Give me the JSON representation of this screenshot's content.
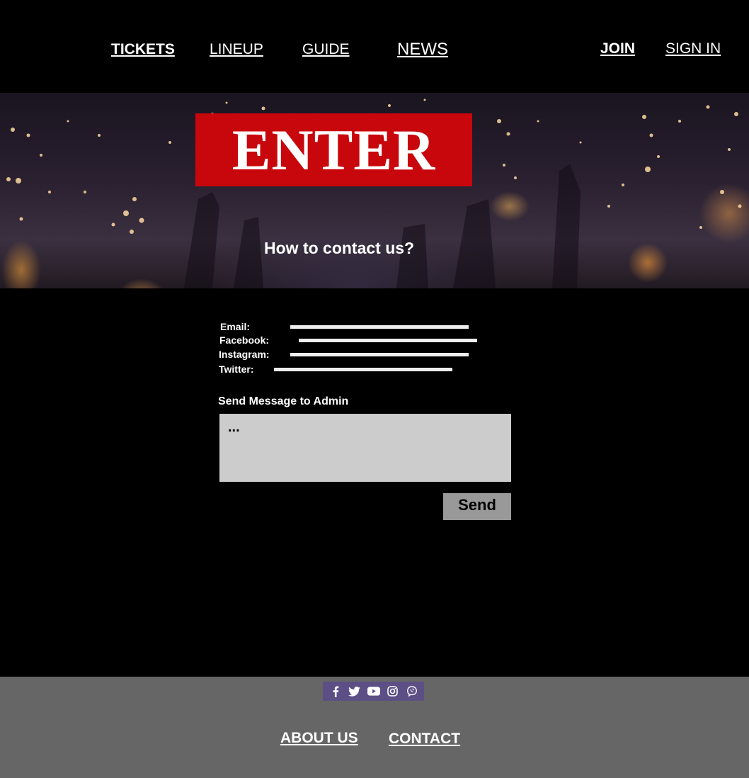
{
  "nav": {
    "tickets": "TICKETS",
    "lineup": "LINEUP",
    "guide": "GUIDE",
    "news": "NEWS",
    "join": "JOIN",
    "sign_in": "SIGN IN"
  },
  "hero": {
    "logo_text": "ENTER",
    "title": "How to contact us?"
  },
  "contact": {
    "email_label": "Email:",
    "facebook_label": "Facebook:",
    "instagram_label": "Instagram:",
    "twitter_label": "Twitter:"
  },
  "message": {
    "heading": "Send Message to Admin",
    "placeholder": "...",
    "send_label": "Send"
  },
  "footer": {
    "social_icons": [
      "facebook-icon",
      "twitter-icon",
      "youtube-icon",
      "instagram-icon",
      "viber-icon"
    ],
    "about": "ABOUT US",
    "contact": "CONTACT"
  },
  "colors": {
    "logo_red": "#c8070d",
    "footer_gray": "#666666",
    "social_bar": "#5b4f86",
    "message_box": "#cccccc",
    "send_button": "#999999"
  }
}
